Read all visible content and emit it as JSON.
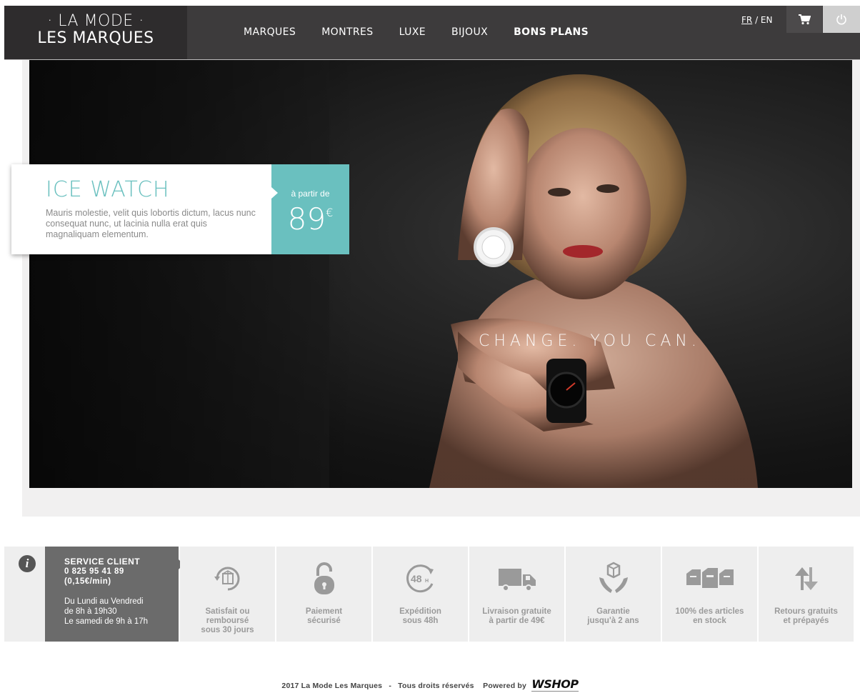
{
  "header": {
    "logo_line1": "· LA MODE ·",
    "logo_line2": "LES MARQUES",
    "nav": [
      {
        "label": "MARQUES"
      },
      {
        "label": "MONTRES"
      },
      {
        "label": "LUXE"
      },
      {
        "label": "BIJOUX"
      },
      {
        "label": "BONS PLANS"
      }
    ],
    "lang_fr": "FR",
    "lang_sep": " / ",
    "lang_en": "EN",
    "icons": {
      "cart": "cart-icon",
      "power": "power-icon"
    }
  },
  "hero": {
    "slogan": "CHANGE. YOU CAN.",
    "promo_title": "ICE WATCH",
    "promo_desc": "Mauris molestie, velit quis lobortis dictum, lacus nunc consequat nunc, ut lacinia nulla erat quis magnaliquam elementum.",
    "price_label": "à partir de",
    "price_value": "89",
    "price_currency": "€",
    "accent_color": "#6ac0bf"
  },
  "services": {
    "client_title": "SERVICE CLIENT",
    "client_phone": "0 825 95 41 89",
    "client_rate": "(0,15€/min)",
    "client_hours1": "Du Lundi au Vendredi",
    "client_hours2": "de 8h à 19h30",
    "client_hours3": "Le samedi de 9h à 17h",
    "items": [
      {
        "icon": "refund-box-icon",
        "line1": "Satisfait ou",
        "line2": "remboursé",
        "line3": "sous 30 jours"
      },
      {
        "icon": "padlock-icon",
        "line1": "Paiement",
        "line2": "sécurisé",
        "line3": ""
      },
      {
        "icon": "clock-48h-icon",
        "line1": "Expédition",
        "line2": "sous 48h",
        "line3": ""
      },
      {
        "icon": "truck-icon",
        "line1": "Livraison gratuite",
        "line2": "à partir de 49€",
        "line3": ""
      },
      {
        "icon": "hands-box-icon",
        "line1": "Garantie",
        "line2": "jusqu'à 2 ans",
        "line3": ""
      },
      {
        "icon": "stock-boxes-icon",
        "line1": "100% des articles",
        "line2": "en stock",
        "line3": ""
      },
      {
        "icon": "return-arrows-icon",
        "line1": "Retours gratuits",
        "line2": "et prépayés",
        "line3": ""
      }
    ]
  },
  "footer": {
    "copyright": "2017 La Mode Les Marques",
    "separator": "-",
    "rights": "Tous droits réservés",
    "powered": "Powered by",
    "brand": "WSHOP"
  }
}
